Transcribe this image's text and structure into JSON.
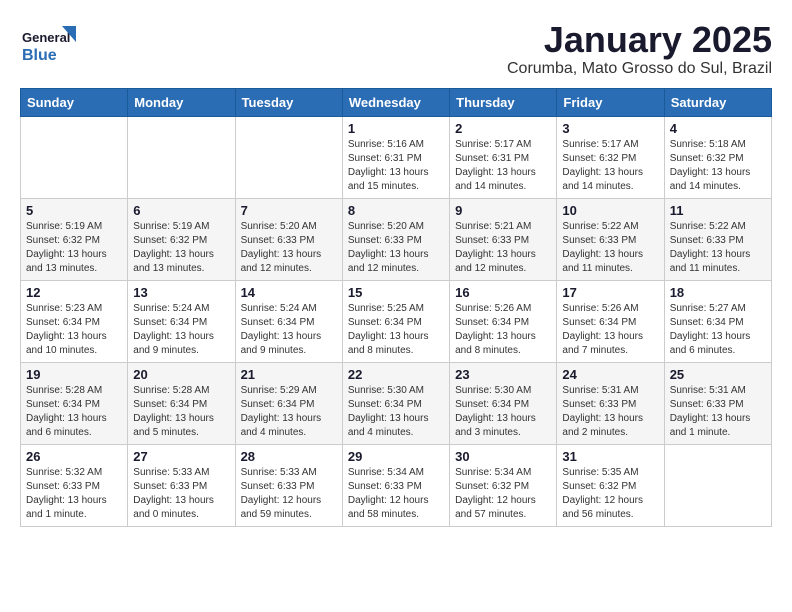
{
  "header": {
    "logo_line1": "General",
    "logo_line2": "Blue",
    "title": "January 2025",
    "subtitle": "Corumba, Mato Grosso do Sul, Brazil"
  },
  "days_of_week": [
    "Sunday",
    "Monday",
    "Tuesday",
    "Wednesday",
    "Thursday",
    "Friday",
    "Saturday"
  ],
  "weeks": [
    [
      {
        "day": "",
        "info": ""
      },
      {
        "day": "",
        "info": ""
      },
      {
        "day": "",
        "info": ""
      },
      {
        "day": "1",
        "info": "Sunrise: 5:16 AM\nSunset: 6:31 PM\nDaylight: 13 hours\nand 15 minutes."
      },
      {
        "day": "2",
        "info": "Sunrise: 5:17 AM\nSunset: 6:31 PM\nDaylight: 13 hours\nand 14 minutes."
      },
      {
        "day": "3",
        "info": "Sunrise: 5:17 AM\nSunset: 6:32 PM\nDaylight: 13 hours\nand 14 minutes."
      },
      {
        "day": "4",
        "info": "Sunrise: 5:18 AM\nSunset: 6:32 PM\nDaylight: 13 hours\nand 14 minutes."
      }
    ],
    [
      {
        "day": "5",
        "info": "Sunrise: 5:19 AM\nSunset: 6:32 PM\nDaylight: 13 hours\nand 13 minutes."
      },
      {
        "day": "6",
        "info": "Sunrise: 5:19 AM\nSunset: 6:32 PM\nDaylight: 13 hours\nand 13 minutes."
      },
      {
        "day": "7",
        "info": "Sunrise: 5:20 AM\nSunset: 6:33 PM\nDaylight: 13 hours\nand 12 minutes."
      },
      {
        "day": "8",
        "info": "Sunrise: 5:20 AM\nSunset: 6:33 PM\nDaylight: 13 hours\nand 12 minutes."
      },
      {
        "day": "9",
        "info": "Sunrise: 5:21 AM\nSunset: 6:33 PM\nDaylight: 13 hours\nand 12 minutes."
      },
      {
        "day": "10",
        "info": "Sunrise: 5:22 AM\nSunset: 6:33 PM\nDaylight: 13 hours\nand 11 minutes."
      },
      {
        "day": "11",
        "info": "Sunrise: 5:22 AM\nSunset: 6:33 PM\nDaylight: 13 hours\nand 11 minutes."
      }
    ],
    [
      {
        "day": "12",
        "info": "Sunrise: 5:23 AM\nSunset: 6:34 PM\nDaylight: 13 hours\nand 10 minutes."
      },
      {
        "day": "13",
        "info": "Sunrise: 5:24 AM\nSunset: 6:34 PM\nDaylight: 13 hours\nand 9 minutes."
      },
      {
        "day": "14",
        "info": "Sunrise: 5:24 AM\nSunset: 6:34 PM\nDaylight: 13 hours\nand 9 minutes."
      },
      {
        "day": "15",
        "info": "Sunrise: 5:25 AM\nSunset: 6:34 PM\nDaylight: 13 hours\nand 8 minutes."
      },
      {
        "day": "16",
        "info": "Sunrise: 5:26 AM\nSunset: 6:34 PM\nDaylight: 13 hours\nand 8 minutes."
      },
      {
        "day": "17",
        "info": "Sunrise: 5:26 AM\nSunset: 6:34 PM\nDaylight: 13 hours\nand 7 minutes."
      },
      {
        "day": "18",
        "info": "Sunrise: 5:27 AM\nSunset: 6:34 PM\nDaylight: 13 hours\nand 6 minutes."
      }
    ],
    [
      {
        "day": "19",
        "info": "Sunrise: 5:28 AM\nSunset: 6:34 PM\nDaylight: 13 hours\nand 6 minutes."
      },
      {
        "day": "20",
        "info": "Sunrise: 5:28 AM\nSunset: 6:34 PM\nDaylight: 13 hours\nand 5 minutes."
      },
      {
        "day": "21",
        "info": "Sunrise: 5:29 AM\nSunset: 6:34 PM\nDaylight: 13 hours\nand 4 minutes."
      },
      {
        "day": "22",
        "info": "Sunrise: 5:30 AM\nSunset: 6:34 PM\nDaylight: 13 hours\nand 4 minutes."
      },
      {
        "day": "23",
        "info": "Sunrise: 5:30 AM\nSunset: 6:34 PM\nDaylight: 13 hours\nand 3 minutes."
      },
      {
        "day": "24",
        "info": "Sunrise: 5:31 AM\nSunset: 6:33 PM\nDaylight: 13 hours\nand 2 minutes."
      },
      {
        "day": "25",
        "info": "Sunrise: 5:31 AM\nSunset: 6:33 PM\nDaylight: 13 hours\nand 1 minute."
      }
    ],
    [
      {
        "day": "26",
        "info": "Sunrise: 5:32 AM\nSunset: 6:33 PM\nDaylight: 13 hours\nand 1 minute."
      },
      {
        "day": "27",
        "info": "Sunrise: 5:33 AM\nSunset: 6:33 PM\nDaylight: 13 hours\nand 0 minutes."
      },
      {
        "day": "28",
        "info": "Sunrise: 5:33 AM\nSunset: 6:33 PM\nDaylight: 12 hours\nand 59 minutes."
      },
      {
        "day": "29",
        "info": "Sunrise: 5:34 AM\nSunset: 6:33 PM\nDaylight: 12 hours\nand 58 minutes."
      },
      {
        "day": "30",
        "info": "Sunrise: 5:34 AM\nSunset: 6:32 PM\nDaylight: 12 hours\nand 57 minutes."
      },
      {
        "day": "31",
        "info": "Sunrise: 5:35 AM\nSunset: 6:32 PM\nDaylight: 12 hours\nand 56 minutes."
      },
      {
        "day": "",
        "info": ""
      }
    ]
  ]
}
